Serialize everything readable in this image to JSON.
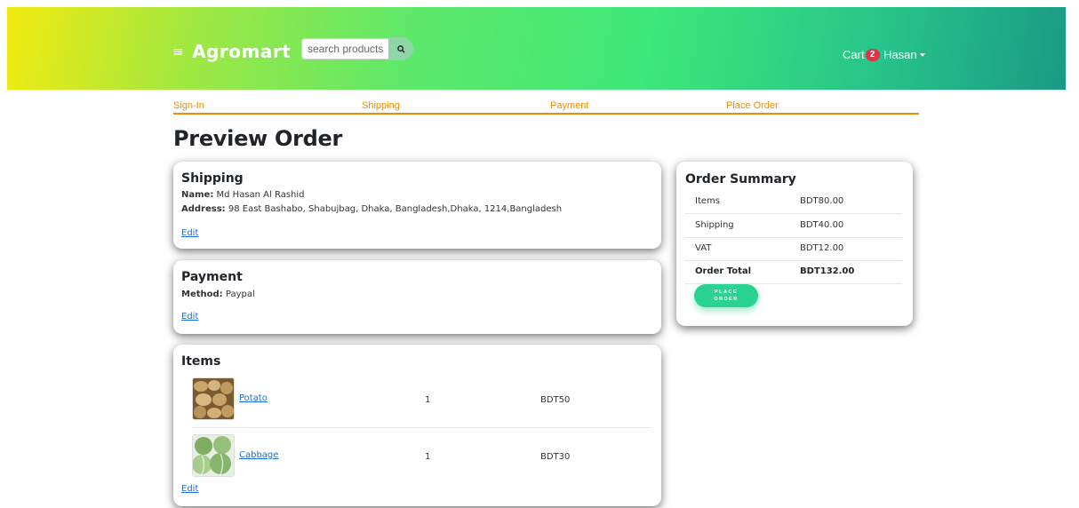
{
  "header": {
    "brand": "Agromart",
    "search_placeholder": "search products...",
    "cart_label": "Cart",
    "cart_count": "2",
    "user_name": "Hasan"
  },
  "steps": [
    "Sign-In",
    "Shipping",
    "Payment",
    "Place Order"
  ],
  "page_title": "Preview Order",
  "shipping": {
    "title": "Shipping",
    "name_label": "Name:",
    "name": "Md Hasan Al Rashid",
    "address_label": "Address:",
    "address": "98 East Bashabo, Shabujbag, Dhaka, Bangladesh,Dhaka, 1214,Bangladesh",
    "edit": "Edit"
  },
  "payment": {
    "title": "Payment",
    "method_label": "Method:",
    "method": "Paypal",
    "edit": "Edit"
  },
  "items": {
    "title": "Items",
    "rows": [
      {
        "name": "Potato",
        "qty": "1",
        "price": "BDT50"
      },
      {
        "name": "Cabbage",
        "qty": "1",
        "price": "BDT30"
      }
    ],
    "edit": "Edit"
  },
  "summary": {
    "title": "Order Summary",
    "rows": [
      {
        "label": "Items",
        "value": "BDT80.00"
      },
      {
        "label": "Shipping",
        "value": "BDT40.00"
      },
      {
        "label": "VAT",
        "value": "BDT12.00"
      },
      {
        "label": "Order Total",
        "value": "BDT132.00"
      }
    ],
    "button_line1": "PLACE",
    "button_line2": "ORDER"
  },
  "colors": {
    "accent_orange": "#f08c00",
    "link_blue": "#1a6fd0",
    "button_green": "#2ad392",
    "badge_red": "#dc3545"
  },
  "icons": {
    "menu": "hamburger-icon",
    "search": "search-icon",
    "caret": "caret-down-icon"
  }
}
